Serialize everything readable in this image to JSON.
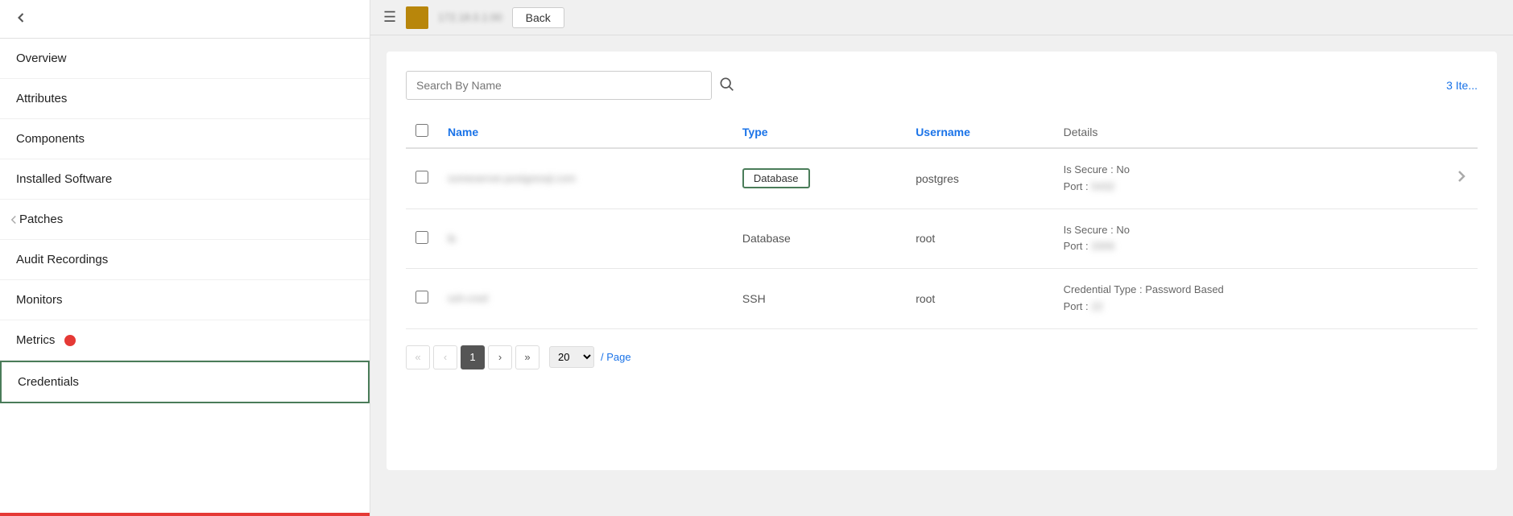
{
  "sidebar": {
    "back_icon": "chevron-left",
    "items": [
      {
        "id": "overview",
        "label": "Overview",
        "active": false,
        "badge": false
      },
      {
        "id": "attributes",
        "label": "Attributes",
        "active": false,
        "badge": false
      },
      {
        "id": "components",
        "label": "Components",
        "active": false,
        "badge": false
      },
      {
        "id": "installed-software",
        "label": "Installed Software",
        "active": false,
        "badge": false
      },
      {
        "id": "patches",
        "label": "Patches",
        "active": false,
        "badge": false
      },
      {
        "id": "audit-recordings",
        "label": "Audit Recordings",
        "active": false,
        "badge": false
      },
      {
        "id": "monitors",
        "label": "Monitors",
        "active": false,
        "badge": false
      },
      {
        "id": "metrics",
        "label": "Metrics",
        "active": false,
        "badge": true
      },
      {
        "id": "credentials",
        "label": "Credentials",
        "active": true,
        "badge": false
      }
    ]
  },
  "topbar": {
    "ip_address": "172.18.0.1:00",
    "back_button": "Back"
  },
  "search": {
    "placeholder": "Search By Name"
  },
  "items_count": "3 Ite...",
  "table": {
    "columns": [
      "",
      "Name",
      "Type",
      "Username",
      "Details"
    ],
    "rows": [
      {
        "name": "someserver.postgresql.com",
        "name_blurred": true,
        "type": "Database",
        "type_outlined": true,
        "username": "postgres",
        "details_line1": "Is Secure : No",
        "details_line2": "Port : ████",
        "has_arrow": true
      },
      {
        "name": "lb",
        "name_blurred": true,
        "type": "Database",
        "type_outlined": false,
        "username": "root",
        "details_line1": "Is Secure : No",
        "details_line2": "Port : ████",
        "has_arrow": false
      },
      {
        "name": "ssh-cred",
        "name_blurred": true,
        "type": "SSH",
        "type_outlined": false,
        "username": "root",
        "details_line1": "Credential Type : Password Based",
        "details_line2": "Port : █",
        "has_arrow": false
      }
    ]
  },
  "pagination": {
    "first_label": "«",
    "prev_label": "‹",
    "current_page": "1",
    "next_label": "›",
    "last_label": "»",
    "page_size": "20",
    "per_page_label": "/ Page"
  }
}
